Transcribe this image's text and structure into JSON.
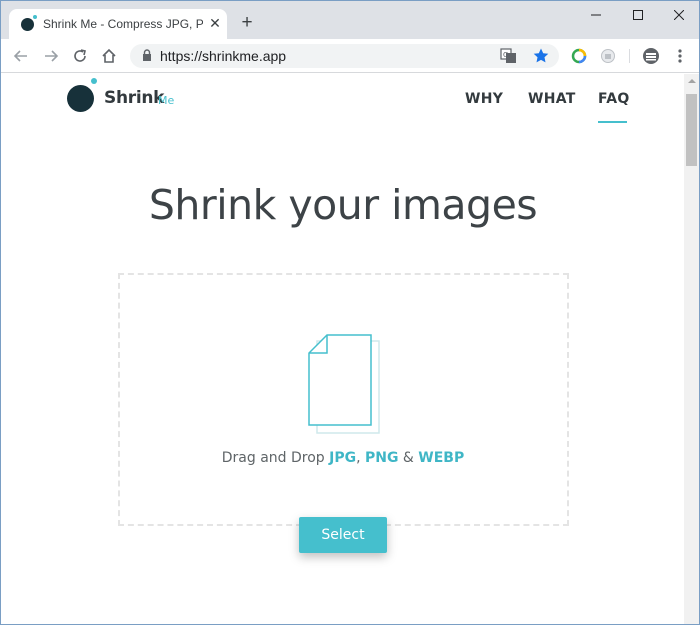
{
  "browser": {
    "tab_title": "Shrink Me - Compress JPG, PNG",
    "tab_close": "✕",
    "new_tab": "+",
    "url": "https://shrinkme.app"
  },
  "site": {
    "logo_main": "Shrink",
    "logo_sub": "Me",
    "nav": [
      {
        "label": "WHY"
      },
      {
        "label": "WHAT"
      },
      {
        "label": "FAQ"
      }
    ],
    "active_nav": "FAQ"
  },
  "hero": {
    "headline": "Shrink your images",
    "drop_prefix": "Drag and Drop",
    "formats": [
      "JPG",
      "PNG",
      "WEBP"
    ],
    "sep_comma": ",",
    "sep_amp": "&",
    "select_label": "Select"
  },
  "colors": {
    "accent": "#45bfcd",
    "brand_dark": "#17313a",
    "text": "#3d4347"
  }
}
